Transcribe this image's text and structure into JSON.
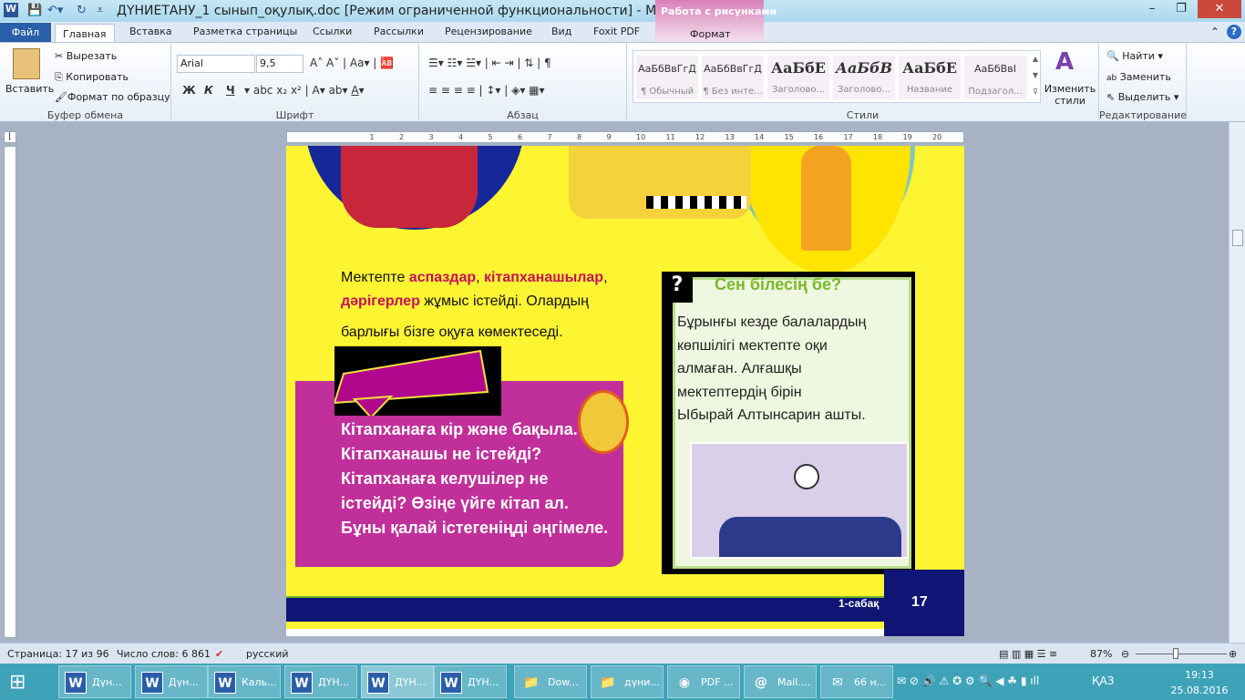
{
  "window": {
    "title": "ДҮНИЕТАНУ_1 сынып_оқулық.doc [Режим ограниченной функциональности]  -  M...",
    "context_group": "Работа с рисунками",
    "context_tab": "Формат"
  },
  "tabs": [
    "Файл",
    "Главная",
    "Вставка",
    "Разметка страницы",
    "Ссылки",
    "Рассылки",
    "Рецензирование",
    "Вид",
    "Foxit PDF"
  ],
  "ribbon": {
    "clipboard": {
      "paste": "Вставить",
      "cut": "Вырезать",
      "copy": "Копировать",
      "format_painter": "Формат по образцу",
      "label": "Буфер обмена"
    },
    "font": {
      "name": "Arial",
      "size": "9,5",
      "label": "Шрифт",
      "bold": "Ж",
      "italic": "К",
      "underline": "Ч"
    },
    "paragraph": {
      "label": "Абзац"
    },
    "styles": {
      "label": "Стили",
      "items": [
        {
          "preview": "АаБбВвГгД",
          "name": "¶ Обычный"
        },
        {
          "preview": "АаБбВвГгД",
          "name": "¶ Без инте..."
        },
        {
          "preview": "АаБбЕ",
          "name": "Заголово..."
        },
        {
          "preview": "АаБбВ",
          "name": "Заголово..."
        },
        {
          "preview": "АаБбЕ",
          "name": "Название"
        },
        {
          "preview": "АаБбВвI",
          "name": "Подзагол..."
        }
      ],
      "change": "Изменить стили"
    },
    "editing": {
      "find": "Найти",
      "replace": "Заменить",
      "select": "Выделить",
      "label": "Редактирование"
    }
  },
  "page": {
    "intro": {
      "p1": "Мектепте ",
      "w1": "аспаздар",
      ", ": ", ",
      "w2": "кітапханашылар",
      "c2": ",",
      "w3": "дәрігерлер",
      "p2": " жұмыс істейді. Олардың",
      "p3": "барлығы бізге оқуға көмектеседі."
    },
    "task_lines": [
      "Кітапханаға  кір және бақыла.",
      "Кітапханашы  не істейді?",
      "Кітапханаға  келушілер не",
      "істейді?  Өзіңе үйге кітап ал.",
      "Бұны қалай істегеніңді  әңгімеле."
    ],
    "did_you_know": {
      "mark": "?",
      "heading": "Сен білесің бе?",
      "lines": [
        "Бұрынғы кезде балалардың",
        "көпшілігі мектепте оқи",
        "алмаған.  Алғашқы",
        "мектептердің бірін",
        "Ыбырай Алтынсарин ашты."
      ]
    },
    "lesson": "1-сабақ",
    "page_number": "17"
  },
  "status": {
    "page": "Страница: 17 из 96",
    "words": "Число слов: 6 861",
    "language": "русский",
    "zoom": "87%",
    "zoom_percent": 87
  },
  "taskbar": {
    "items": [
      {
        "icon": "W",
        "label": "Дүн..."
      },
      {
        "icon": "W",
        "label": "Дүн..."
      },
      {
        "icon": "W",
        "label": "Каль..."
      },
      {
        "icon": "W",
        "label": "ДҮН..."
      },
      {
        "icon": "W",
        "label": "ДҮН..."
      },
      {
        "icon": "W",
        "label": "ДҮН..."
      },
      {
        "icon": "folder",
        "label": "Dow..."
      },
      {
        "icon": "folder",
        "label": "дүни..."
      },
      {
        "icon": "chrome",
        "label": "PDF ..."
      },
      {
        "icon": "mail-agent",
        "label": "Mail...."
      },
      {
        "icon": "envelope",
        "label": "66 н..."
      }
    ],
    "lang": "ҚАЗ",
    "time": "19:13",
    "date": "25.08.2016"
  },
  "colors": {
    "page_yellow": "#fdf432",
    "magenta": "#c02f9a",
    "navy": "#0e1575",
    "green_heading": "#7ab828",
    "keyword_red": "#c8105b",
    "taskbar": "#3ea3b9"
  }
}
